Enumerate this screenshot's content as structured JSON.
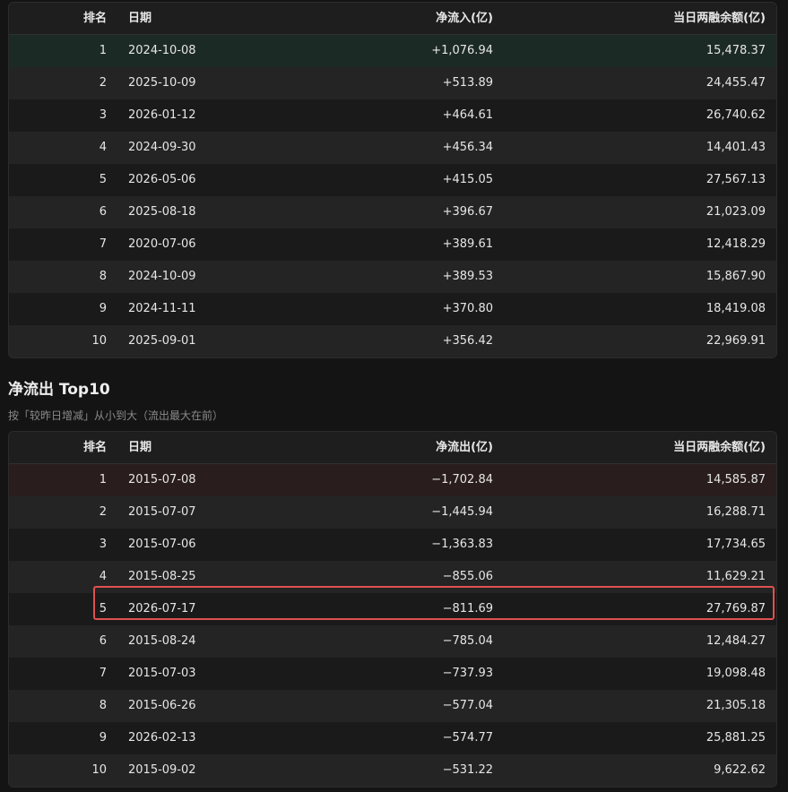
{
  "inflow": {
    "columns": {
      "rank": "排名",
      "date": "日期",
      "flow": "净流入(亿)",
      "balance": "当日两融余额(亿)"
    },
    "rows": [
      {
        "rank": "1",
        "date": "2024-10-08",
        "flow": "+1,076.94",
        "balance": "15,478.37"
      },
      {
        "rank": "2",
        "date": "2025-10-09",
        "flow": "+513.89",
        "balance": "24,455.47"
      },
      {
        "rank": "3",
        "date": "2026-01-12",
        "flow": "+464.61",
        "balance": "26,740.62"
      },
      {
        "rank": "4",
        "date": "2024-09-30",
        "flow": "+456.34",
        "balance": "14,401.43"
      },
      {
        "rank": "5",
        "date": "2026-05-06",
        "flow": "+415.05",
        "balance": "27,567.13"
      },
      {
        "rank": "6",
        "date": "2025-08-18",
        "flow": "+396.67",
        "balance": "21,023.09"
      },
      {
        "rank": "7",
        "date": "2020-07-06",
        "flow": "+389.61",
        "balance": "12,418.29"
      },
      {
        "rank": "8",
        "date": "2024-10-09",
        "flow": "+389.53",
        "balance": "15,867.90"
      },
      {
        "rank": "9",
        "date": "2024-11-11",
        "flow": "+370.80",
        "balance": "18,419.08"
      },
      {
        "rank": "10",
        "date": "2025-09-01",
        "flow": "+356.42",
        "balance": "22,969.91"
      }
    ]
  },
  "outflow_section": {
    "title": "净流出 Top10",
    "description": "按「较昨日增减」从小到大（流出最大在前）"
  },
  "outflow": {
    "columns": {
      "rank": "排名",
      "date": "日期",
      "flow": "净流出(亿)",
      "balance": "当日两融余额(亿)"
    },
    "rows": [
      {
        "rank": "1",
        "date": "2015-07-08",
        "flow": "−1,702.84",
        "balance": "14,585.87"
      },
      {
        "rank": "2",
        "date": "2015-07-07",
        "flow": "−1,445.94",
        "balance": "16,288.71"
      },
      {
        "rank": "3",
        "date": "2015-07-06",
        "flow": "−1,363.83",
        "balance": "17,734.65"
      },
      {
        "rank": "4",
        "date": "2015-08-25",
        "flow": "−855.06",
        "balance": "11,629.21"
      },
      {
        "rank": "5",
        "date": "2026-07-17",
        "flow": "−811.69",
        "balance": "27,769.87"
      },
      {
        "rank": "6",
        "date": "2015-08-24",
        "flow": "−785.04",
        "balance": "12,484.27"
      },
      {
        "rank": "7",
        "date": "2015-07-03",
        "flow": "−737.93",
        "balance": "19,098.48"
      },
      {
        "rank": "8",
        "date": "2015-06-26",
        "flow": "−577.04",
        "balance": "21,305.18"
      },
      {
        "rank": "9",
        "date": "2026-02-13",
        "flow": "−574.77",
        "balance": "25,881.25"
      },
      {
        "rank": "10",
        "date": "2015-09-02",
        "flow": "−531.22",
        "balance": "9,622.62"
      }
    ]
  },
  "colors": {
    "background": "#141414",
    "highlight_border": "#e0504f",
    "top_inflow_row": "#1c2a25",
    "top_outflow_row": "#2a1d1d"
  }
}
